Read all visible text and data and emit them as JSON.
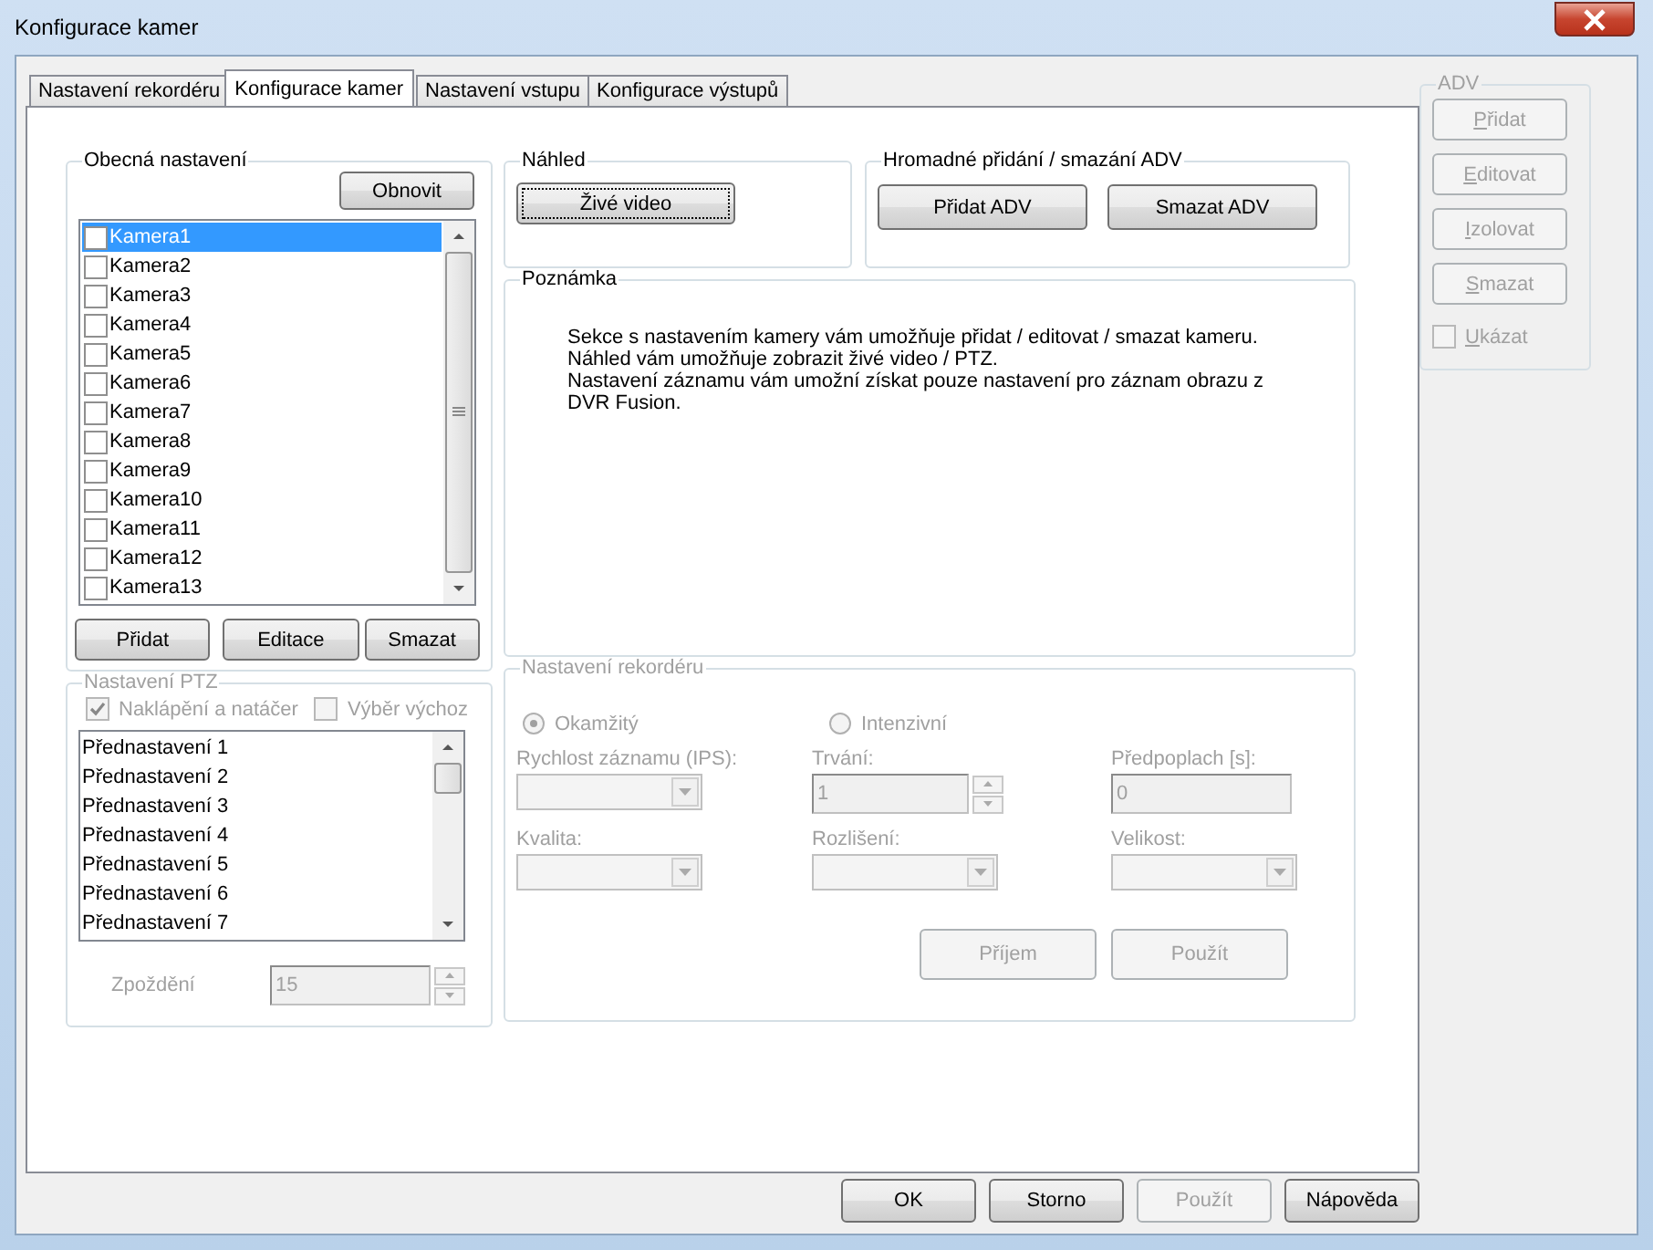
{
  "window": {
    "title": "Konfigurace kamer"
  },
  "tabs": [
    {
      "label": "Nastavení rekordéru",
      "selected": false
    },
    {
      "label": "Konfigurace kamer",
      "selected": true
    },
    {
      "label": "Nastavení vstupu",
      "selected": false
    },
    {
      "label": "Konfigurace výstupů",
      "selected": false
    }
  ],
  "general": {
    "title": "Obecná nastavení",
    "refresh_button": "Obnovit",
    "cameras": [
      {
        "label": "Kamera1",
        "checked": false,
        "selected": true
      },
      {
        "label": "Kamera2",
        "checked": false,
        "selected": false
      },
      {
        "label": "Kamera3",
        "checked": false,
        "selected": false
      },
      {
        "label": "Kamera4",
        "checked": false,
        "selected": false
      },
      {
        "label": "Kamera5",
        "checked": false,
        "selected": false
      },
      {
        "label": "Kamera6",
        "checked": false,
        "selected": false
      },
      {
        "label": "Kamera7",
        "checked": false,
        "selected": false
      },
      {
        "label": "Kamera8",
        "checked": false,
        "selected": false
      },
      {
        "label": "Kamera9",
        "checked": false,
        "selected": false
      },
      {
        "label": "Kamera10",
        "checked": false,
        "selected": false
      },
      {
        "label": "Kamera11",
        "checked": false,
        "selected": false
      },
      {
        "label": "Kamera12",
        "checked": false,
        "selected": false
      },
      {
        "label": "Kamera13",
        "checked": false,
        "selected": false
      }
    ],
    "buttons": [
      "Přidat",
      "Editace",
      "Smazat"
    ]
  },
  "ptz": {
    "title": "Nastavení PTZ",
    "disabled": true,
    "pan_tilt": {
      "label": "Naklápění a natáčer",
      "checked": true
    },
    "default_select": {
      "label": "Výběr výchoz",
      "checked": false
    },
    "presets": [
      "Přednastavení 1",
      "Přednastavení 2",
      "Přednastavení 3",
      "Přednastavení 4",
      "Přednastavení 5",
      "Přednastavení 6",
      "Přednastavení 7"
    ],
    "delay": {
      "label": "Zpoždění",
      "value": "15"
    }
  },
  "preview": {
    "title": "Náhled",
    "button": "Živé video"
  },
  "bulk": {
    "title": "Hromadné přidání / smazání ADV",
    "buttons": [
      "Přidat ADV",
      "Smazat ADV"
    ]
  },
  "note": {
    "title": "Poznámka",
    "lines": [
      "Sekce s nastavením kamery vám umožňuje přidat / editovat / smazat kameru.",
      "Náhled vám umožňuje zobrazit živé video / PTZ.",
      "Nastavení záznamu vám umožní získat pouze nastavení pro záznam obrazu z",
      "DVR Fusion."
    ]
  },
  "recorder": {
    "title": "Nastavení rekordéru",
    "disabled": true,
    "modes": [
      {
        "label": "Okamžitý",
        "selected": true
      },
      {
        "label": "Intenzivní",
        "selected": false
      }
    ],
    "fields": [
      {
        "kind": "dropdown",
        "label": "Rychlost záznamu (IPS):"
      },
      {
        "kind": "spin",
        "label": "Trvání:",
        "value": "1"
      },
      {
        "kind": "text",
        "label": "Předpoplach [s]:",
        "value": "0"
      },
      {
        "kind": "dropdown",
        "label": "Kvalita:"
      },
      {
        "kind": "dropdown",
        "label": "Rozlišení:"
      },
      {
        "kind": "dropdown",
        "label": "Velikost:"
      }
    ],
    "buttons": [
      "Příjem",
      "Použít"
    ]
  },
  "adv": {
    "title": "ADV",
    "disabled": true,
    "buttons": [
      "Přidat",
      "Editovat",
      "Izolovat",
      "Smazat"
    ],
    "show": {
      "label": "Ukázat",
      "checked": false
    }
  },
  "footer": [
    {
      "label": "OK",
      "disabled": false
    },
    {
      "label": "Storno",
      "disabled": false
    },
    {
      "label": "Použít",
      "disabled": true
    },
    {
      "label": "Nápověda",
      "disabled": false
    }
  ]
}
